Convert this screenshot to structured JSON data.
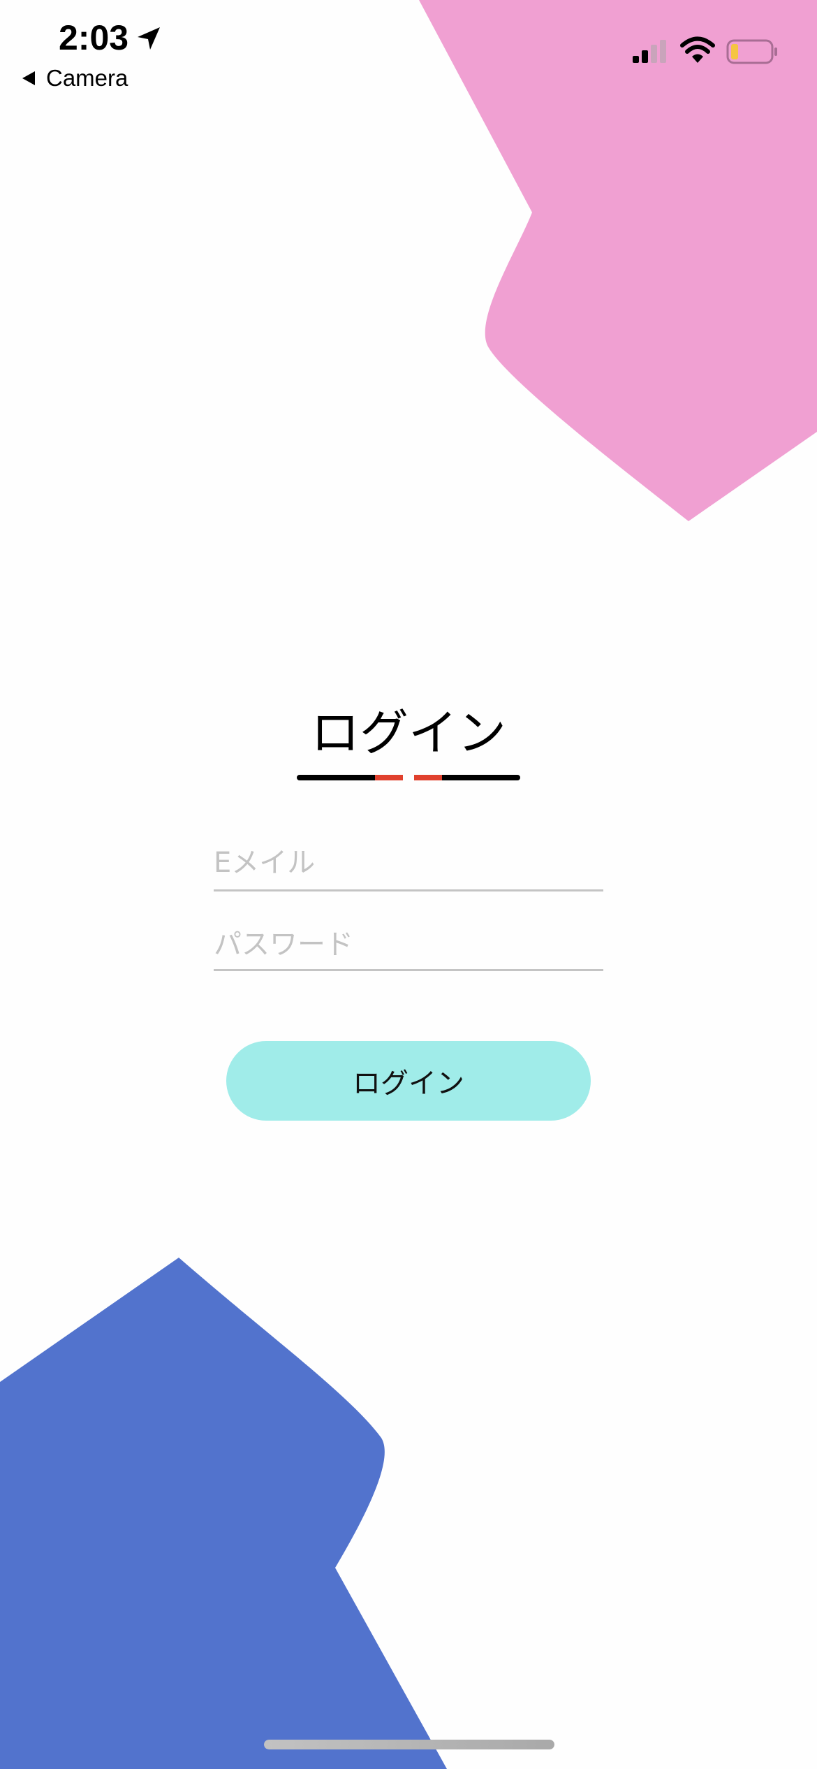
{
  "status_bar": {
    "time": "2:03",
    "back_label": "Camera",
    "icons": [
      "location-arrow-icon",
      "back-triangle-icon",
      "cellular-signal-icon",
      "wifi-icon",
      "battery-icon"
    ]
  },
  "login": {
    "title": "ログイン",
    "email_placeholder": "Eメイル",
    "email_value": "",
    "password_placeholder": "パスワード",
    "password_value": "",
    "button_label": "ログイン"
  },
  "colors": {
    "pink_shape": "#f0a0d2",
    "blue_shape": "#5273cd",
    "button": "#a0ece9",
    "underline_accent": "#e0402d",
    "underline": "#000000",
    "field_line": "#c4c4c4",
    "placeholder": "#c3c3c3",
    "battery_level": "#f5c542"
  }
}
